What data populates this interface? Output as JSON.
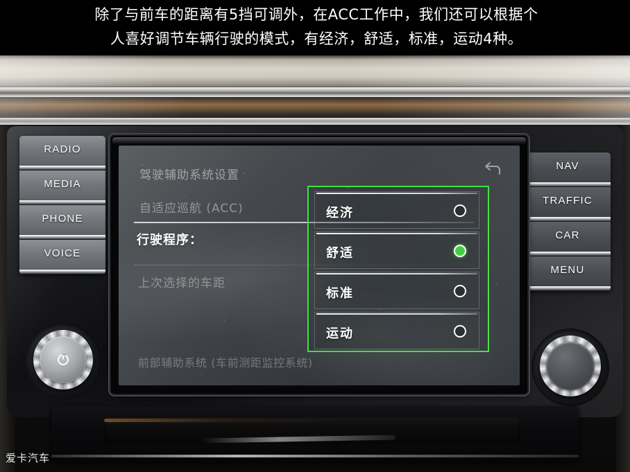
{
  "caption": {
    "line1": "除了与前车的距离有5挡可调外，在ACC工作中，我们还可以根据个",
    "line2": "人喜好调节车辆行驶的模式，有经济，舒适，标准，运动4种。"
  },
  "colors": {
    "accent_green": "#3ee03e",
    "selected_radio": "#3fcc3f",
    "screen_text": "#ffffff",
    "button_label": "#ffffff"
  },
  "head_unit": {
    "left_buttons": [
      {
        "label": "RADIO",
        "name": "radio-button"
      },
      {
        "label": "MEDIA",
        "name": "media-button"
      },
      {
        "label": "PHONE",
        "name": "phone-button"
      },
      {
        "label": "VOICE",
        "name": "voice-button"
      }
    ],
    "right_buttons": [
      {
        "label": "NAV",
        "name": "nav-button"
      },
      {
        "label": "TRAFFIC",
        "name": "traffic-button"
      },
      {
        "label": "CAR",
        "name": "car-button"
      },
      {
        "label": "MENU",
        "name": "menu-button"
      }
    ],
    "left_knob_icon": "power-icon",
    "right_knob_icon": "tuning-knob"
  },
  "screen": {
    "title": "驾驶辅助系统设置",
    "back_icon": "back-arrow-icon",
    "row_acc": "自适应巡航 (ACC)",
    "row_driving_program": "行驶程序：",
    "row_last_distance": "上次选择的车距",
    "row_front_assist": "前部辅助系统 (车前测距监控系统)",
    "popup": {
      "options": [
        {
          "label": "经济",
          "selected": false
        },
        {
          "label": "舒适",
          "selected": true
        },
        {
          "label": "标准",
          "selected": false
        },
        {
          "label": "运动",
          "selected": false
        }
      ]
    }
  },
  "watermark": "爱卡汽车"
}
